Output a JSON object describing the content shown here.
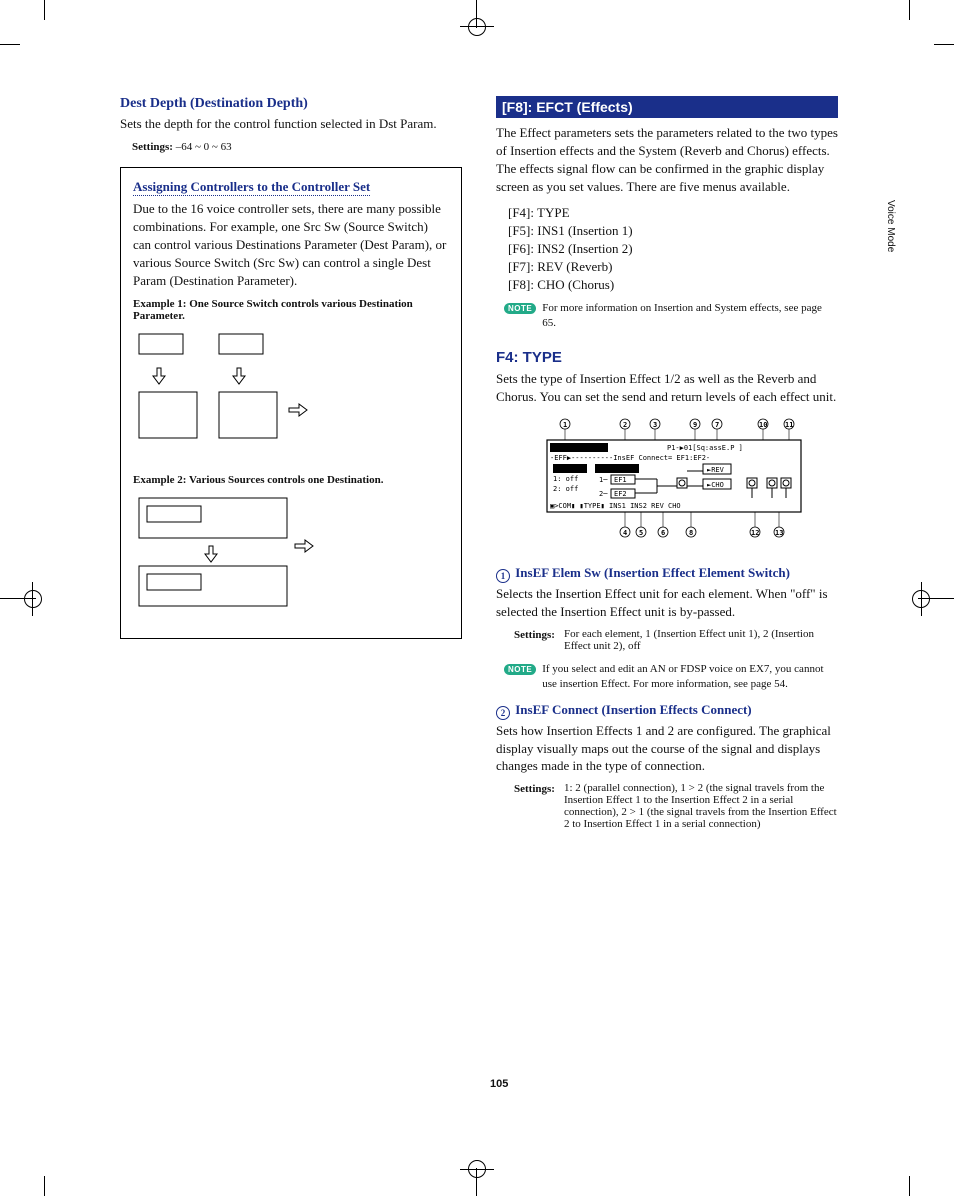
{
  "left": {
    "dest_depth_h": "Dest Depth (Destination Depth)",
    "dest_depth_body": "Sets the depth for the control function selected in Dst Param.",
    "dest_depth_settings_lbl": "Settings:",
    "dest_depth_settings_val": "–64 ~ 0 ~ 63",
    "assign_h": "Assigning Controllers to the Controller Set",
    "assign_body": "Due to the 16 voice controller sets, there are many possible combinations. For example, one Src Sw (Source Switch) can control various Destinations Parameter (Dest Param), or various Source Switch (Src Sw) can control a single Dest Param (Destination Parameter).",
    "ex1_title": "Example 1: One Source Switch controls various Destination Parameter.",
    "ex2_title": "Example 2: Various Sources controls one Destination."
  },
  "right": {
    "f8_bar": "[F8]: EFCT (Effects)",
    "f8_body": "The Effect parameters sets the parameters related to the two types of Insertion effects and the System (Reverb and Chorus) effects. The effects signal flow can be confirmed in the graphic display screen as you set values. There are five menus available.",
    "menu": {
      "f4": "[F4]: TYPE",
      "f5": "[F5]: INS1 (Insertion 1)",
      "f6": "[F6]: INS2 (Insertion 2)",
      "f7": "[F7]: REV (Reverb)",
      "f8": "[F8]: CHO (Chorus)"
    },
    "note1": "For more information on Insertion and System effects, see page 65.",
    "f4_h": "F4: TYPE",
    "f4_body": "Sets the type of Insertion Effect 1/2 as well as the Reverb and Chorus. You can set the send and return levels of each effect unit.",
    "screen": {
      "title": "VOICE EDIT",
      "header_right": "P1-▶01[Sq:assE.P    ]",
      "line2": "-EFF▶----------InsEF Connect= EF1:EF2-",
      "row_insef": "-InsEF  ▮EF1:EF2▮",
      "row1": "1:  off",
      "row2": "2:  off",
      "row2b": "2─┤EF2├",
      "row1b": "1─┤EF1├",
      "rev": "►REV",
      "cho": "►CHO",
      "footer": "▣>COM▮         ▮TYPE▮ INS1  INS2   REV   CHO"
    },
    "callouts": [
      "1",
      "2",
      "3",
      "4",
      "5",
      "6",
      "7",
      "8",
      "9",
      "10",
      "11",
      "12",
      "13"
    ],
    "p1_h": "InsEF Elem Sw (Insertion Effect Element Switch)",
    "p1_body": "Selects the Insertion Effect unit for each element. When \"off\" is selected the Insertion Effect unit is by-passed.",
    "p1_settings_lbl": "Settings:",
    "p1_settings_val": "For each element, 1 (Insertion Effect unit 1), 2 (Insertion Effect unit 2), off",
    "note2": "If you select and edit an AN or FDSP voice on EX7, you cannot use insertion Effect. For more information, see page 54.",
    "p2_h": "InsEF Connect (Insertion Effects Connect)",
    "p2_body": "Sets how Insertion Effects 1 and 2 are configured. The graphical display visually maps out the course of the signal and displays changes made in the type of connection.",
    "p2_settings_lbl": "Settings:",
    "p2_settings_val": "1: 2 (parallel connection), 1 > 2 (the signal travels from the Insertion Effect 1 to the Insertion Effect 2 in a serial connection), 2 > 1 (the signal travels from the Insertion Effect 2 to Insertion Effect 1 in a serial connection)"
  },
  "side_tab": "Voice Mode",
  "page_number": "105",
  "note_badge": "NOTE"
}
